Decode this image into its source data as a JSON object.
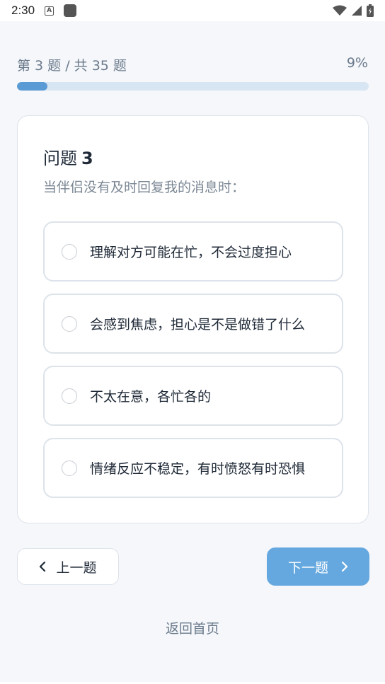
{
  "status_bar": {
    "time": "2:30",
    "a_label": "A"
  },
  "progress": {
    "label_prefix": "第",
    "current": "3",
    "label_mid": "题 / 共",
    "total": "35",
    "label_suffix": "题",
    "label": "第 3 题 / 共 35 题",
    "percent_text": "9%",
    "fraction": 0.086
  },
  "question": {
    "title_prefix": "问题",
    "number": "3",
    "text": "当伴侣没有及时回复我的消息时："
  },
  "options": [
    {
      "text": "理解对方可能在忙，不会过度担心"
    },
    {
      "text": "会感到焦虑，担心是不是做错了什么"
    },
    {
      "text": "不太在意，各忙各的"
    },
    {
      "text": "情绪反应不稳定，有时愤怒有时恐惧"
    }
  ],
  "nav": {
    "prev_label": "上一题",
    "next_label": "下一题",
    "home_label": "返回首页"
  },
  "colors": {
    "accent": "#5b9bd5",
    "next_button": "#65a8df",
    "track": "#d8e6f3"
  }
}
